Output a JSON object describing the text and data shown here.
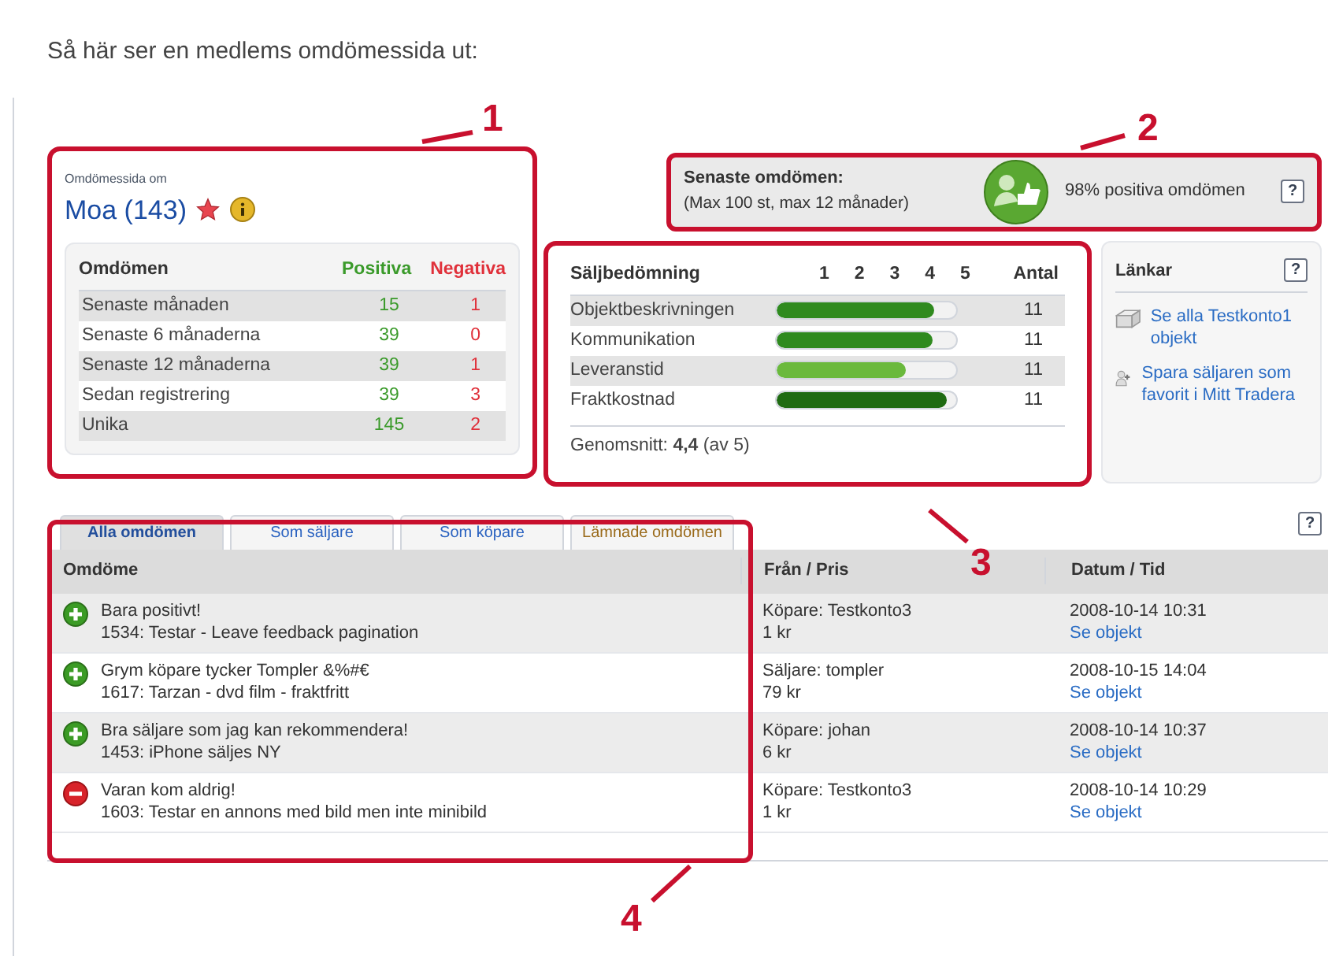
{
  "heading": "Så här ser en medlems omdömessida ut:",
  "profile": {
    "caption": "Omdömessida om",
    "name": "Moa (143)",
    "table": {
      "columns": [
        "Omdömen",
        "Positiva",
        "Negativa"
      ],
      "rows": [
        {
          "label": "Senaste månaden",
          "positive": "15",
          "negative": "1"
        },
        {
          "label": "Senaste 6 månaderna",
          "positive": "39",
          "negative": "0"
        },
        {
          "label": "Senaste 12 månaderna",
          "positive": "39",
          "negative": "1"
        },
        {
          "label": "Sedan registrering",
          "positive": "39",
          "negative": "3"
        },
        {
          "label": "Unika",
          "positive": "145",
          "negative": "2"
        }
      ]
    }
  },
  "recent": {
    "title": "Senaste omdömen:",
    "subtitle": "(Max 100 st, max 12 månader)",
    "summary": "98% positiva omdömen",
    "help": "?"
  },
  "seller_rating": {
    "columns": [
      "Säljbedömning",
      "1",
      "2",
      "3",
      "4",
      "5",
      "Antal"
    ],
    "rows": [
      {
        "label": "Objektbeskrivningen",
        "level": 0.88,
        "count": "11"
      },
      {
        "label": "Kommunikation",
        "level": 0.87,
        "count": "11"
      },
      {
        "label": "Leveranstid",
        "level": 0.72,
        "count": "11"
      },
      {
        "label": "Fraktkostnad",
        "level": 0.95,
        "count": "11"
      }
    ],
    "average_label": "Genomsnitt:",
    "average": "4,4",
    "average_of": "(av 5)"
  },
  "links": {
    "title": "Länkar",
    "help": "?",
    "items": [
      {
        "kind": "box",
        "text": "Se alla Testkonto1 objekt"
      },
      {
        "kind": "add-user",
        "text": "Spara säljaren som favorit i Mitt Tradera"
      }
    ]
  },
  "tabs": [
    {
      "label": "Alla omdömen",
      "selected": true
    },
    {
      "label": "Som säljare",
      "selected": false
    },
    {
      "label": "Som köpare",
      "selected": false
    },
    {
      "label": "Lämnade omdömen",
      "selected": false
    }
  ],
  "tabs_help": "?",
  "feedback_table": {
    "columns": [
      "Omdöme",
      "Från / Pris",
      "Datum / Tid"
    ],
    "rows": [
      {
        "kind": "positive",
        "comment": "Bara positivt!",
        "item": "1534: Testar - Leave feedback pagination",
        "from": "Köpare: Testkonto3",
        "price": "1 kr",
        "date": "2008-10-14 10:31",
        "link": "Se objekt"
      },
      {
        "kind": "positive",
        "comment": "Grym köpare tycker Tompler &%#€",
        "item": "1617: Tarzan - dvd film - fraktfritt",
        "from": "Säljare: tompler",
        "price": "79 kr",
        "date": "2008-10-15 14:04",
        "link": "Se objekt"
      },
      {
        "kind": "positive",
        "comment": "Bra säljare som jag kan rekommendera!",
        "item": "1453: iPhone säljes NY",
        "from": "Köpare: johan",
        "price": "6 kr",
        "date": "2008-10-14 10:37",
        "link": "Se objekt"
      },
      {
        "kind": "negative",
        "comment": "Varan kom aldrig!",
        "item": "1603: Testar en annons med bild men inte minibild",
        "from": "Köpare: Testkonto3",
        "price": "1 kr",
        "date": "2008-10-14 10:29",
        "link": "Se objekt"
      }
    ]
  },
  "annotations": [
    {
      "label": "1"
    },
    {
      "label": "2"
    },
    {
      "label": "3"
    },
    {
      "label": "4"
    }
  ]
}
